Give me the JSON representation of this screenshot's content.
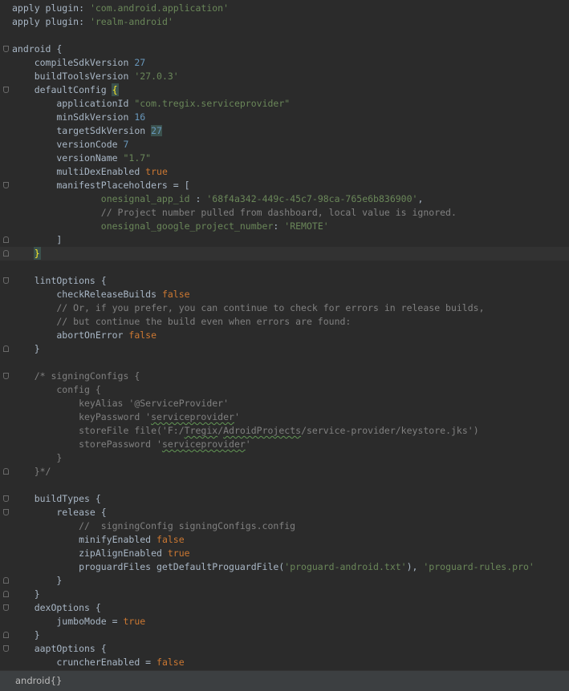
{
  "editor": {
    "lines": [
      {
        "fold": "",
        "current": false,
        "segments": [
          {
            "t": "apply plugin: ",
            "c": "text"
          },
          {
            "t": "'com.android.application'",
            "c": "str"
          }
        ]
      },
      {
        "fold": "",
        "current": false,
        "segments": [
          {
            "t": "apply plugin: ",
            "c": "text"
          },
          {
            "t": "'realm-android'",
            "c": "str"
          }
        ]
      },
      {
        "fold": "",
        "current": false,
        "segments": []
      },
      {
        "fold": "open",
        "current": false,
        "segments": [
          {
            "t": "android {",
            "c": "text"
          }
        ]
      },
      {
        "fold": "",
        "current": false,
        "segments": [
          {
            "t": "    compileSdkVersion ",
            "c": "text"
          },
          {
            "t": "27",
            "c": "num"
          }
        ]
      },
      {
        "fold": "",
        "current": false,
        "segments": [
          {
            "t": "    buildToolsVersion ",
            "c": "text"
          },
          {
            "t": "'27.0.3'",
            "c": "str"
          }
        ]
      },
      {
        "fold": "open",
        "current": false,
        "segments": [
          {
            "t": "    defaultConfig ",
            "c": "text"
          },
          {
            "t": "{",
            "c": "brace"
          }
        ]
      },
      {
        "fold": "",
        "current": false,
        "segments": [
          {
            "t": "        applicationId ",
            "c": "text"
          },
          {
            "t": "\"com.tregix.serviceprovider\"",
            "c": "str"
          }
        ]
      },
      {
        "fold": "",
        "current": false,
        "segments": [
          {
            "t": "        minSdkVersion ",
            "c": "text"
          },
          {
            "t": "16",
            "c": "num"
          }
        ]
      },
      {
        "fold": "",
        "current": false,
        "segments": [
          {
            "t": "        targetSdkVersion ",
            "c": "text"
          },
          {
            "t": "27",
            "c": "hl"
          }
        ]
      },
      {
        "fold": "",
        "current": false,
        "segments": [
          {
            "t": "        versionCode ",
            "c": "text"
          },
          {
            "t": "7",
            "c": "num"
          }
        ]
      },
      {
        "fold": "",
        "current": false,
        "segments": [
          {
            "t": "        versionName ",
            "c": "text"
          },
          {
            "t": "\"1.7\"",
            "c": "str"
          }
        ]
      },
      {
        "fold": "",
        "current": false,
        "segments": [
          {
            "t": "        multiDexEnabled ",
            "c": "text"
          },
          {
            "t": "true",
            "c": "kw"
          }
        ]
      },
      {
        "fold": "open",
        "current": false,
        "segments": [
          {
            "t": "        manifestPlaceholders = [",
            "c": "text"
          }
        ]
      },
      {
        "fold": "",
        "current": false,
        "segments": [
          {
            "t": "                onesignal_app_id",
            "c": "str"
          },
          {
            "t": " : ",
            "c": "text"
          },
          {
            "t": "'68f4a342-449c-45c7-98ca-765e6b836900'",
            "c": "str"
          },
          {
            "t": ",",
            "c": "text"
          }
        ]
      },
      {
        "fold": "",
        "current": false,
        "segments": [
          {
            "t": "                // Project number pulled from dashboard, local value is ignored.",
            "c": "com"
          }
        ]
      },
      {
        "fold": "",
        "current": false,
        "segments": [
          {
            "t": "                onesignal_google_project_number",
            "c": "str"
          },
          {
            "t": ": ",
            "c": "text"
          },
          {
            "t": "'REMOTE'",
            "c": "str"
          }
        ]
      },
      {
        "fold": "close",
        "current": false,
        "segments": [
          {
            "t": "        ]",
            "c": "text"
          }
        ]
      },
      {
        "fold": "close",
        "current": true,
        "segments": [
          {
            "t": "    ",
            "c": "text"
          },
          {
            "t": "}",
            "c": "brace"
          },
          {
            "t": "",
            "c": "caret"
          }
        ]
      },
      {
        "fold": "",
        "current": false,
        "segments": []
      },
      {
        "fold": "open",
        "current": false,
        "segments": [
          {
            "t": "    lintOptions {",
            "c": "text"
          }
        ]
      },
      {
        "fold": "",
        "current": false,
        "segments": [
          {
            "t": "        checkReleaseBuilds ",
            "c": "text"
          },
          {
            "t": "false",
            "c": "kw"
          }
        ]
      },
      {
        "fold": "",
        "current": false,
        "segments": [
          {
            "t": "        // Or, if you prefer, you can continue to check for errors in release builds,",
            "c": "com"
          }
        ]
      },
      {
        "fold": "",
        "current": false,
        "segments": [
          {
            "t": "        // but continue the build even when errors are found:",
            "c": "com"
          }
        ]
      },
      {
        "fold": "",
        "current": false,
        "segments": [
          {
            "t": "        abortOnError ",
            "c": "text"
          },
          {
            "t": "false",
            "c": "kw"
          }
        ]
      },
      {
        "fold": "close",
        "current": false,
        "segments": [
          {
            "t": "    }",
            "c": "text"
          }
        ]
      },
      {
        "fold": "",
        "current": false,
        "segments": []
      },
      {
        "fold": "open",
        "current": false,
        "segments": [
          {
            "t": "    /* signingConfigs {",
            "c": "com"
          }
        ]
      },
      {
        "fold": "",
        "current": false,
        "segments": [
          {
            "t": "        config {",
            "c": "com"
          }
        ]
      },
      {
        "fold": "",
        "current": false,
        "segments": [
          {
            "t": "            keyAlias '@ServiceProvider'",
            "c": "com"
          }
        ]
      },
      {
        "fold": "",
        "current": false,
        "segments": [
          {
            "t": "            keyPassword '",
            "c": "com"
          },
          {
            "t": "serviceprovider",
            "c": "comtypo"
          },
          {
            "t": "'",
            "c": "com"
          }
        ]
      },
      {
        "fold": "",
        "current": false,
        "segments": [
          {
            "t": "            storeFile file('F:/",
            "c": "com"
          },
          {
            "t": "Tregix",
            "c": "comtypo"
          },
          {
            "t": "/",
            "c": "com"
          },
          {
            "t": "AdroidProjects",
            "c": "comtypo"
          },
          {
            "t": "/service-provider/keystore.jks')",
            "c": "com"
          }
        ]
      },
      {
        "fold": "",
        "current": false,
        "segments": [
          {
            "t": "            storePassword '",
            "c": "com"
          },
          {
            "t": "serviceprovider",
            "c": "comtypo"
          },
          {
            "t": "'",
            "c": "com"
          }
        ]
      },
      {
        "fold": "",
        "current": false,
        "segments": [
          {
            "t": "        }",
            "c": "com"
          }
        ]
      },
      {
        "fold": "close",
        "current": false,
        "segments": [
          {
            "t": "    }*/",
            "c": "com"
          }
        ]
      },
      {
        "fold": "",
        "current": false,
        "segments": []
      },
      {
        "fold": "open",
        "current": false,
        "segments": [
          {
            "t": "    buildTypes {",
            "c": "text"
          }
        ]
      },
      {
        "fold": "open",
        "current": false,
        "segments": [
          {
            "t": "        release {",
            "c": "text"
          }
        ]
      },
      {
        "fold": "",
        "current": false,
        "segments": [
          {
            "t": "            //  signingConfig signingConfigs.config",
            "c": "com"
          }
        ]
      },
      {
        "fold": "",
        "current": false,
        "segments": [
          {
            "t": "            minifyEnabled ",
            "c": "text"
          },
          {
            "t": "false",
            "c": "kw"
          }
        ]
      },
      {
        "fold": "",
        "current": false,
        "segments": [
          {
            "t": "            zipAlignEnabled ",
            "c": "text"
          },
          {
            "t": "true",
            "c": "kw"
          }
        ]
      },
      {
        "fold": "",
        "current": false,
        "segments": [
          {
            "t": "            proguardFiles getDefaultProguardFile(",
            "c": "text"
          },
          {
            "t": "'proguard-android.txt'",
            "c": "str"
          },
          {
            "t": "), ",
            "c": "text"
          },
          {
            "t": "'proguard-rules.pro'",
            "c": "str"
          }
        ]
      },
      {
        "fold": "close",
        "current": false,
        "segments": [
          {
            "t": "        }",
            "c": "text"
          }
        ]
      },
      {
        "fold": "close",
        "current": false,
        "segments": [
          {
            "t": "    }",
            "c": "text"
          }
        ]
      },
      {
        "fold": "open",
        "current": false,
        "segments": [
          {
            "t": "    dexOptions {",
            "c": "text"
          }
        ]
      },
      {
        "fold": "",
        "current": false,
        "segments": [
          {
            "t": "        jumboMode = ",
            "c": "text"
          },
          {
            "t": "true",
            "c": "kw"
          }
        ]
      },
      {
        "fold": "close",
        "current": false,
        "segments": [
          {
            "t": "    }",
            "c": "text"
          }
        ]
      },
      {
        "fold": "open",
        "current": false,
        "segments": [
          {
            "t": "    aaptOptions {",
            "c": "text"
          }
        ]
      },
      {
        "fold": "",
        "current": false,
        "segments": [
          {
            "t": "        cruncherEnabled = ",
            "c": "text"
          },
          {
            "t": "false",
            "c": "kw"
          }
        ]
      }
    ]
  },
  "breadcrumb": {
    "label": "android{}"
  },
  "colors": {
    "background": "#2b2b2b",
    "text": "#a9b7c6",
    "string": "#6a8759",
    "number": "#6897bb",
    "keyword": "#cc7832",
    "comment": "#808080",
    "current_line": "#323232",
    "brace_match": "#ffef28",
    "statusbar": "#3c3f41"
  }
}
